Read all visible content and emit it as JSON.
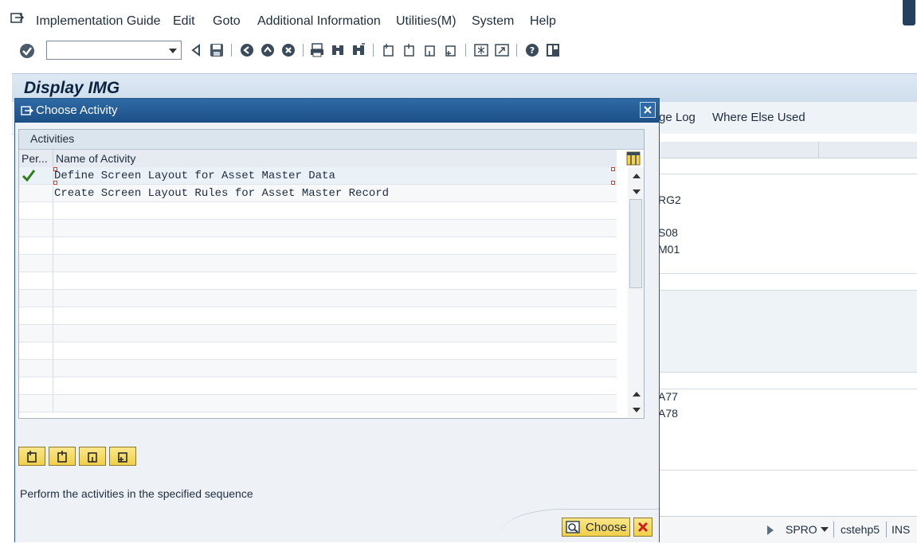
{
  "menubar": {
    "items": [
      {
        "label": "Implementation Guide"
      },
      {
        "label": "Edit"
      },
      {
        "label": "Goto"
      },
      {
        "label": "Additional Information"
      },
      {
        "label": "Utilities(M)"
      },
      {
        "label": "System"
      },
      {
        "label": "Help"
      }
    ]
  },
  "toolbar": {
    "command_field_value": "",
    "icons": [
      "enter-icon",
      "back-icon",
      "save-icon",
      "back-nav-icon",
      "exit-icon",
      "cancel-icon",
      "print-icon",
      "find-icon",
      "find-next-icon",
      "first-page-icon",
      "previous-page-icon",
      "next-page-icon",
      "last-page-icon",
      "create-session-icon",
      "shortcut-icon",
      "help-icon",
      "customize-layout-icon"
    ]
  },
  "main": {
    "title": "Display IMG",
    "app_toolbar": {
      "change_log_fragment": "ge Log",
      "where_else_used": "Where Else Used"
    },
    "visible_codes": [
      "RG2",
      "S08",
      "M01",
      "A77",
      "A78"
    ]
  },
  "dialog": {
    "title": "Choose Activity",
    "panel_title": "Activities",
    "columns": {
      "performed": "Per...",
      "name": "Name of Activity"
    },
    "rows": [
      {
        "performed": true,
        "name": "Define Screen Layout for Asset Master Data"
      },
      {
        "performed": false,
        "name": "Create Screen Layout Rules for Asset Master Record"
      }
    ],
    "hint": "Perform the activities in the specified sequence",
    "choose_label": "Choose"
  },
  "statusbar": {
    "transaction": "SPRO",
    "server": "cstehp5",
    "mode": "INS"
  },
  "colors": {
    "dialog_title_bar": "#1c4f86",
    "button_yellow": "#f0cf4a",
    "check_green": "#2e7d1a",
    "cancel_red": "#cc2020"
  }
}
